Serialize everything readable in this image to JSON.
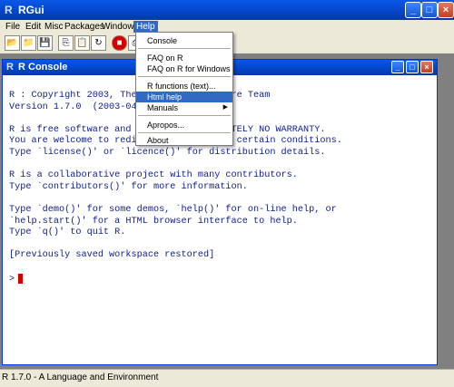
{
  "app": {
    "title": "RGui",
    "logo": "R"
  },
  "menubar": {
    "items": [
      "File",
      "Edit",
      "Misc",
      "Packages",
      "Windows",
      "Help"
    ]
  },
  "toolbar": {
    "buttons": [
      "open-script-icon",
      "load-workspace-icon",
      "save-icon",
      "copy-icon",
      "paste-icon",
      "refresh-icon",
      "stop-icon",
      "print-icon"
    ]
  },
  "console_window": {
    "title": "R Console",
    "logo": "R",
    "lines": [
      "R : Copyright 2003, The R Development Core Team",
      "Version 1.7.0  (2003-04-16)",
      "",
      "R is free software and comes with ABSOLUTELY NO WARRANTY.",
      "You are welcome to redistribute it under certain conditions.",
      "Type `license()' or `licence()' for distribution details.",
      "",
      "R is a collaborative project with many contributors.",
      "Type `contributors()' for more information.",
      "",
      "Type `demo()' for some demos, `help()' for on-line help, or",
      "`help.start()' for a HTML browser interface to help.",
      "Type `q()' to quit R.",
      "",
      "[Previously saved workspace restored]",
      ""
    ],
    "prompt": ">"
  },
  "help_menu": {
    "items": [
      {
        "label": "Console"
      },
      {
        "label": "FAQ on R"
      },
      {
        "label": "FAQ on R for Windows"
      },
      {
        "label": "R functions (text)..."
      },
      {
        "label": "Html help"
      },
      {
        "label": "Manuals",
        "submenu_arrow": "▶"
      },
      {
        "label": "Apropos..."
      },
      {
        "label": "About"
      }
    ],
    "highlighted": "Html help"
  },
  "statusbar": {
    "text": "R 1.7.0 - A Language and Environment"
  },
  "colors": {
    "titlebar": "#0344c7",
    "highlight": "#316ac5",
    "console_text": "#102090",
    "cursor": "#d40000"
  }
}
